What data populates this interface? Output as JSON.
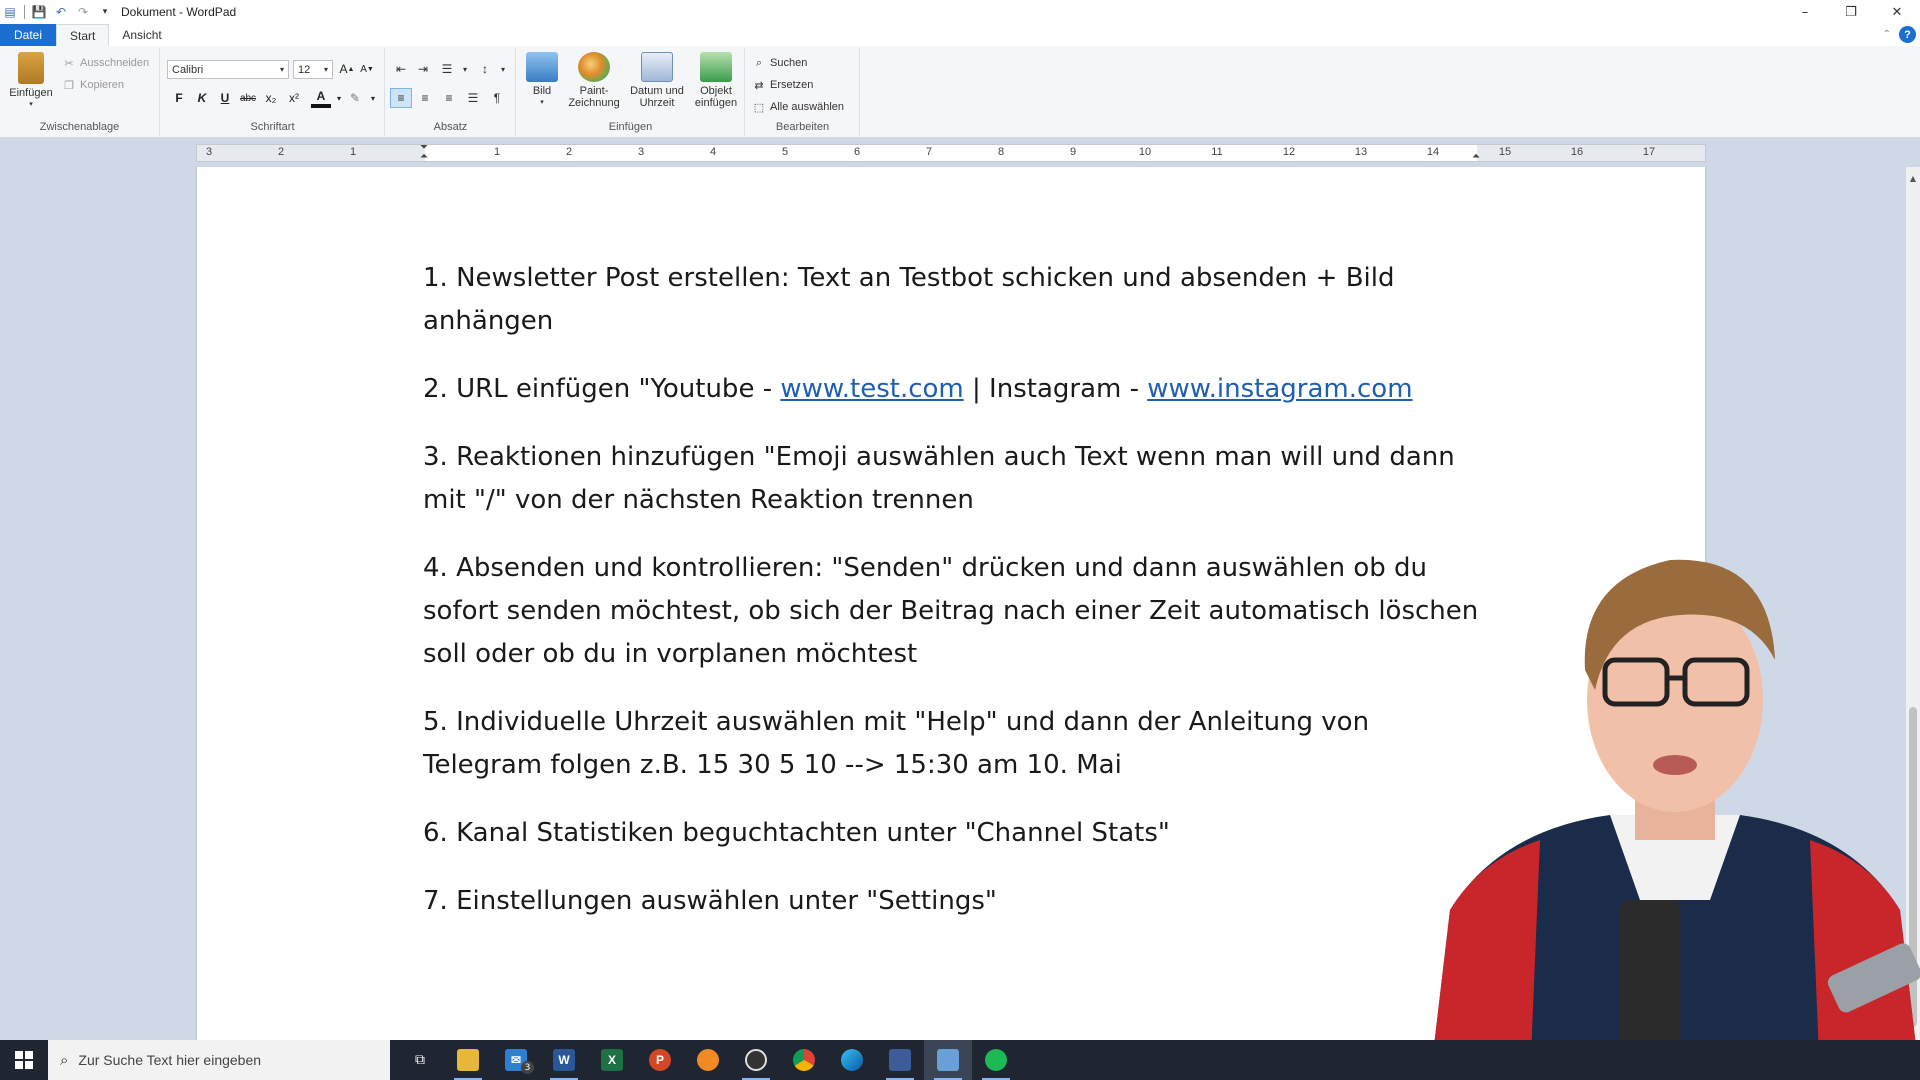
{
  "window": {
    "title": "Dokument - WordPad",
    "controls": {
      "minimize": "–",
      "restore": "❐",
      "close": "✕"
    }
  },
  "tabs": {
    "file": "Datei",
    "start": "Start",
    "view": "Ansicht"
  },
  "ribbon": {
    "clipboard": {
      "label": "Zwischenablage",
      "paste": "Einfügen",
      "cut": "Ausschneiden",
      "copy": "Kopieren"
    },
    "font": {
      "label": "Schriftart",
      "family": "Calibri",
      "size": "12",
      "bold": "F",
      "italic": "K",
      "underline": "U",
      "strike": "abc",
      "subscript": "x₂",
      "superscript": "x²",
      "font_color": "A",
      "highlight": "✎"
    },
    "paragraph": {
      "label": "Absatz"
    },
    "insert": {
      "label": "Einfügen",
      "picture": "Bild",
      "paint": "Paint-Zeichnung",
      "datetime": "Datum und Uhrzeit",
      "object": "Objekt einfügen"
    },
    "edit": {
      "label": "Bearbeiten",
      "find": "Suchen",
      "replace": "Ersetzen",
      "select_all": "Alle auswählen"
    }
  },
  "ruler": {
    "numbers": [
      "3",
      "2",
      "1",
      "1",
      "2",
      "3",
      "4",
      "5",
      "6",
      "7",
      "8",
      "9",
      "10",
      "11",
      "12",
      "13",
      "14",
      "15",
      "16",
      "17"
    ]
  },
  "document": {
    "item1": "1. Newsletter Post erstellen: Text an Testbot schicken und absenden + Bild anhängen",
    "item2_prefix": "2. URL einfügen \"Youtube - ",
    "item2_link1": "www.test.com",
    "item2_middle": " | Instagram - ",
    "item2_link2": "www.instagram.com",
    "item3": "3. Reaktionen hinzufügen \"Emoji auswählen auch Text wenn man will und dann mit \"/\" von der nächsten Reaktion trennen",
    "item4": "4. Absenden und kontrollieren: \"Senden\" drücken und dann auswählen ob du sofort senden möchtest, ob sich der Beitrag nach einer Zeit automatisch löschen soll oder ob du in vorplanen möchtest",
    "item5": "5. Individuelle Uhrzeit auswählen mit \"Help\" und dann der Anleitung von Telegram folgen z.B. 15 30 5 10 --> 15:30 am 10. Mai",
    "item6": "6. Kanal Statistiken beguchtachten unter \"Channel Stats\"",
    "item7": "7. Einstellungen auswählen unter \"Settings\""
  },
  "taskbar": {
    "search_placeholder": "Zur Suche Text hier eingeben",
    "mail_badge": "3",
    "apps": [
      "task-view",
      "file-explorer",
      "mail",
      "word",
      "excel",
      "powerpoint",
      "app-orange",
      "obs",
      "chrome",
      "edge",
      "app-blue",
      "wordpad",
      "spotify"
    ]
  }
}
